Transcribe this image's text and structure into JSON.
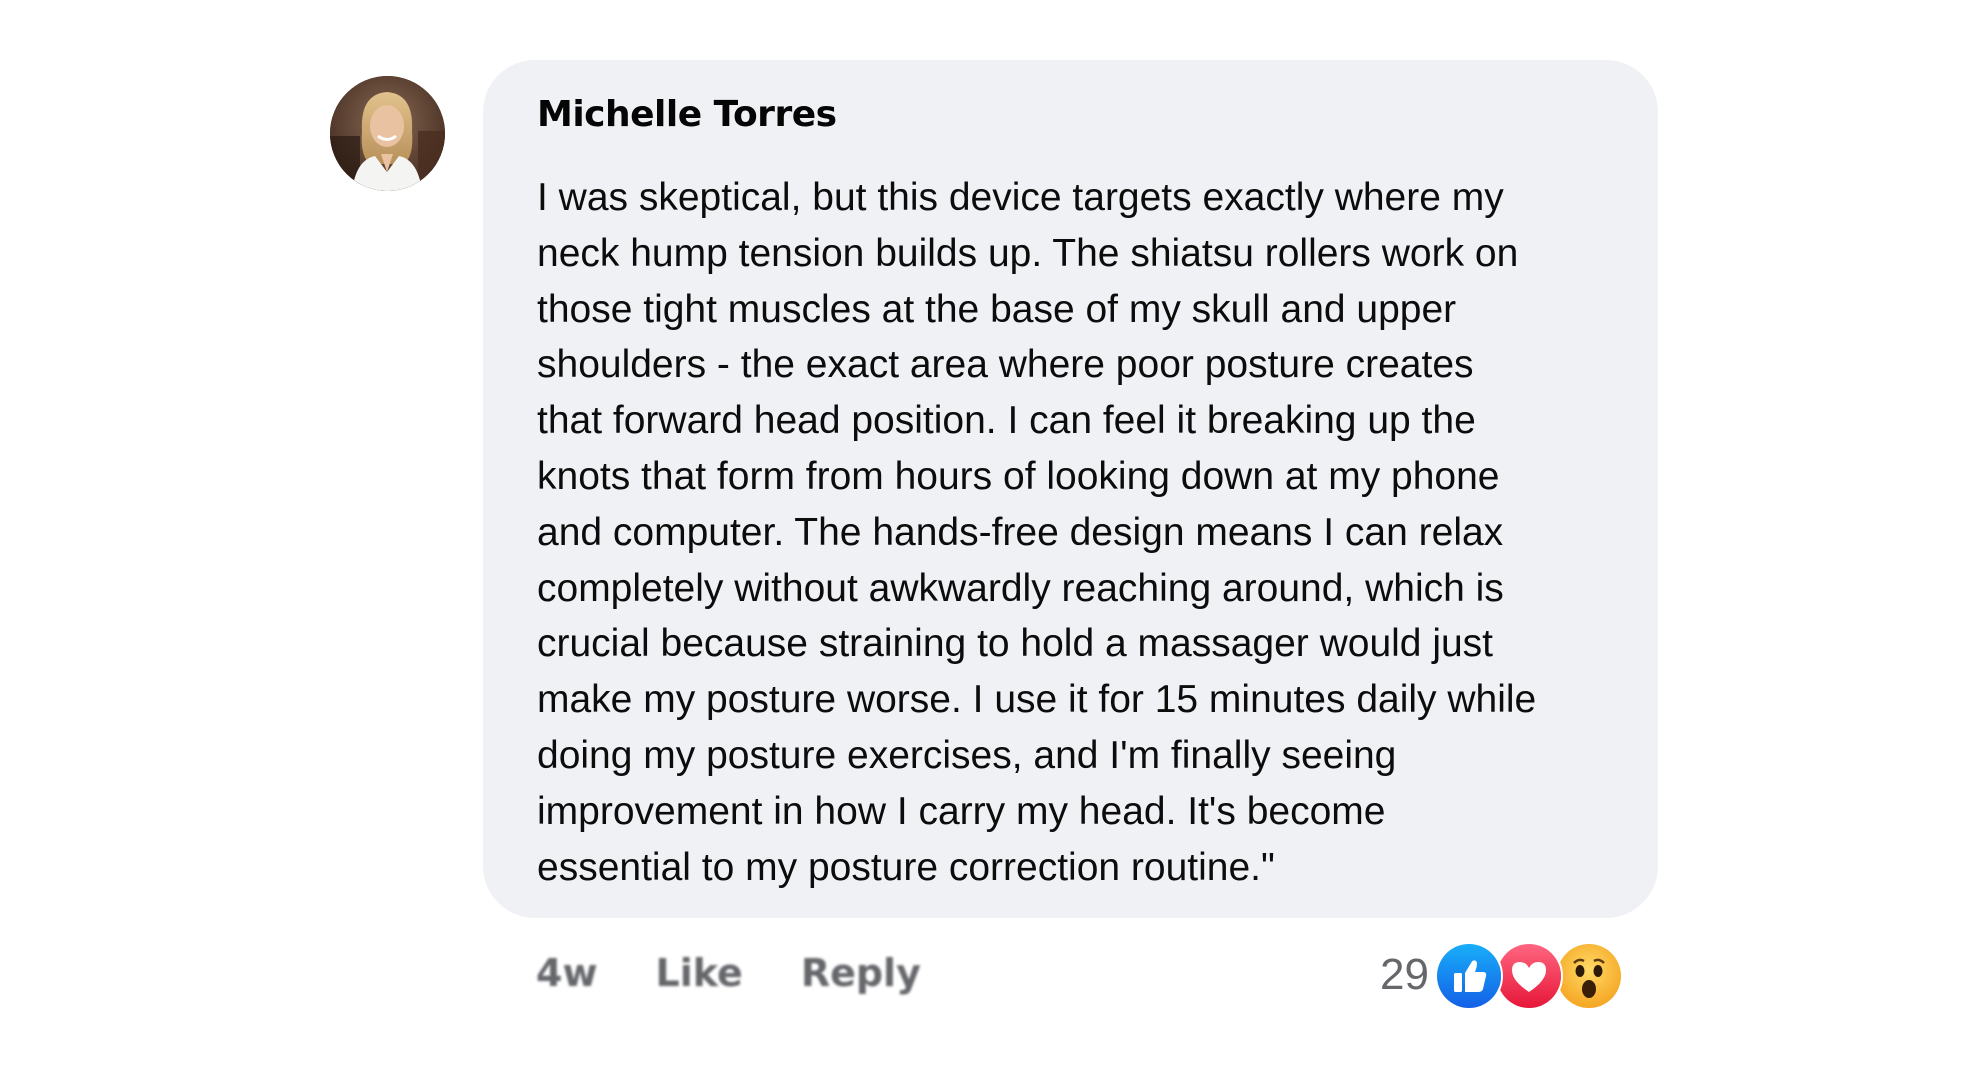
{
  "comment": {
    "author": "Michelle Torres",
    "text": "I was skeptical, but this device targets exactly where my\nneck hump tension builds up. The shiatsu rollers work on\nthose tight muscles at the base of my skull and upper\nshoulders - the exact area where poor posture creates\nthat forward head position. I can feel it breaking up the\nknots that form from hours of looking down at my phone\nand computer. The hands-free design means I can relax\ncompletely without awkwardly reaching around, which is\ncrucial because straining to hold a massager would just\nmake my posture worse. I use it for 15 minutes daily while\ndoing my posture exercises, and I'm finally seeing\nimprovement in how I carry my head. It's become\nessential to my posture correction routine.\"",
    "avatar_icon": "user-avatar-photo"
  },
  "actions": {
    "time": "4w",
    "like_label": "Like",
    "reply_label": "Reply"
  },
  "reactions": {
    "count": "29",
    "icons": [
      "like-reaction-icon",
      "love-reaction-icon",
      "wow-reaction-icon"
    ]
  },
  "colors": {
    "bubble_bg": "#f0f1f5",
    "text": "#0c0c0c",
    "meta": "#65676b",
    "like_blue": "#1877f2",
    "love_red": "#f33e58",
    "wow_yellow": "#f7b125"
  }
}
